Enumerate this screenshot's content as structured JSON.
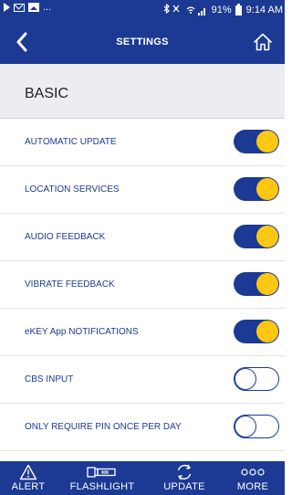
{
  "status_bar": {
    "notification_dots": "...",
    "right_icons": "✳ ⚠",
    "signal": "☷.░",
    "battery_percent": "91%",
    "time": "9:14 AM"
  },
  "header": {
    "title": "SETTINGS",
    "back_icon": "chevron-left-icon",
    "home_icon": "home-icon"
  },
  "section": {
    "title": "BASIC"
  },
  "settings": [
    {
      "label": "AUTOMATIC UPDATE",
      "enabled": true
    },
    {
      "label": "LOCATION SERVICES",
      "enabled": true
    },
    {
      "label": "AUDIO FEEDBACK",
      "enabled": true
    },
    {
      "label": "VIBRATE FEEDBACK",
      "enabled": true
    },
    {
      "label": "eKEY App NOTIFICATIONS",
      "enabled": true
    },
    {
      "label": "CBS INPUT",
      "enabled": false
    },
    {
      "label": "ONLY REQUIRE PIN ONCE PER DAY",
      "enabled": false
    }
  ],
  "bottom_nav": [
    {
      "label": "ALERT",
      "icon": "warning-icon"
    },
    {
      "label": "FLASHLIGHT",
      "icon": "flashlight-icon"
    },
    {
      "label": "UPDATE",
      "icon": "sync-icon"
    },
    {
      "label": "MORE",
      "icon": "more-icon"
    }
  ],
  "colors": {
    "primary": "#1c3a94",
    "toggle_knob_on": "#fdc813",
    "section_background": "#ececf1"
  }
}
